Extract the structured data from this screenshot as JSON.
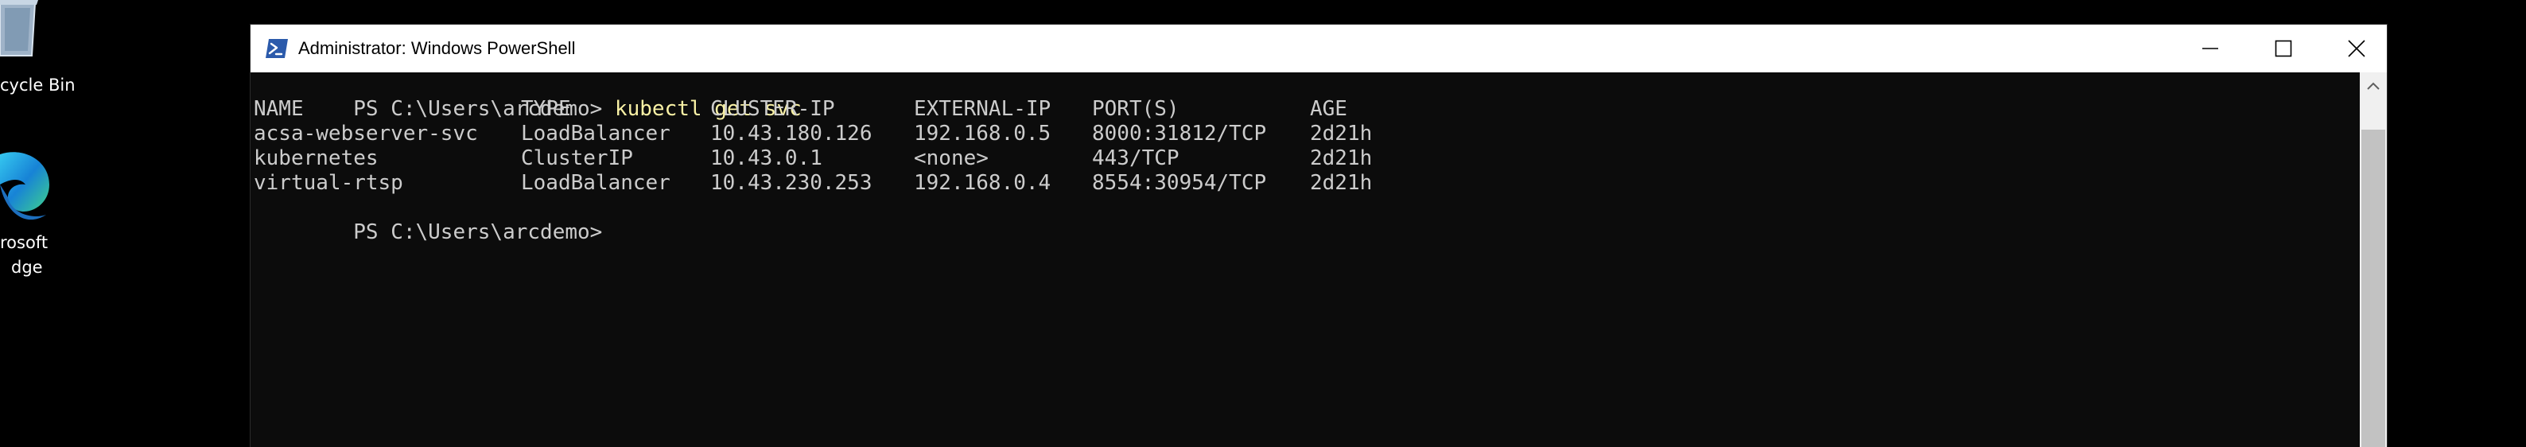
{
  "desktop": {
    "icons": [
      {
        "label": "cycle Bin"
      },
      {
        "label_line1": "rosoft",
        "label_line2": "dge"
      }
    ]
  },
  "window": {
    "title": "Administrator: Windows PowerShell",
    "controls": {
      "minimize": "—",
      "maximize": "☐",
      "close": "✕"
    }
  },
  "console": {
    "prompt1": "PS C:\\Users\\arcdemo> ",
    "command": "kubectl get svc",
    "headers": [
      "NAME",
      "TYPE",
      "CLUSTER-IP",
      "EXTERNAL-IP",
      "PORT(S)",
      "AGE"
    ],
    "rows": [
      [
        "acsa-webserver-svc",
        "LoadBalancer",
        "10.43.180.126",
        "192.168.0.5",
        "8000:31812/TCP",
        "2d21h"
      ],
      [
        "kubernetes",
        "ClusterIP",
        "10.43.0.1",
        "<none>",
        "443/TCP",
        "2d21h"
      ],
      [
        "virtual-rtsp",
        "LoadBalancer",
        "10.43.230.253",
        "192.168.0.4",
        "8554:30954/TCP",
        "2d21h"
      ]
    ],
    "prompt2": "PS C:\\Users\\arcdemo>"
  },
  "colors": {
    "console_bg": "#0c0c0c",
    "console_text": "#cccccc",
    "command_text": "#f9f1a5",
    "titlebar_bg": "#ffffff",
    "powershell_blue": "#2b5aab"
  }
}
